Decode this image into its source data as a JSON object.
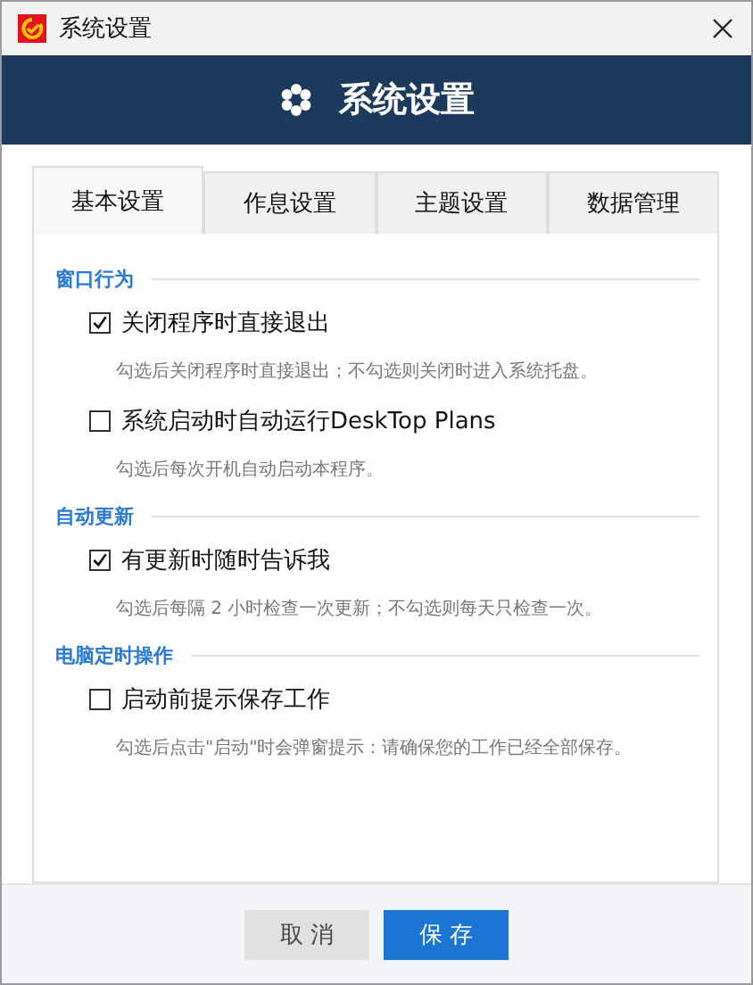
{
  "window": {
    "title": "系统设置"
  },
  "header": {
    "title": "系统设置"
  },
  "tabs": [
    {
      "label": "基本设置",
      "selected": true
    },
    {
      "label": "作息设置",
      "selected": false
    },
    {
      "label": "主题设置",
      "selected": false
    },
    {
      "label": "数据管理",
      "selected": false
    }
  ],
  "sections": [
    {
      "title": "窗口行为",
      "options": [
        {
          "label": "关闭程序时直接退出",
          "checked": true,
          "hint": "勾选后关闭程序时直接退出；不勾选则关闭时进入系统托盘。"
        },
        {
          "label": "系统启动时自动运行DeskTop Plans",
          "checked": false,
          "hint": "勾选后每次开机自动启动本程序。"
        }
      ]
    },
    {
      "title": "自动更新",
      "options": [
        {
          "label": "有更新时随时告诉我",
          "checked": true,
          "hint": "勾选后每隔 2 小时检查一次更新；不勾选则每天只检查一次。"
        }
      ]
    },
    {
      "title": "电脑定时操作",
      "options": [
        {
          "label": "启动前提示保存工作",
          "checked": false,
          "hint": "勾选后点击\"启动\"时会弹窗提示：请确保您的工作已经全部保存。"
        }
      ]
    }
  ],
  "buttons": [
    {
      "label": "取 消",
      "kind": "secondary"
    },
    {
      "label": "保 存",
      "kind": "primary"
    }
  ]
}
